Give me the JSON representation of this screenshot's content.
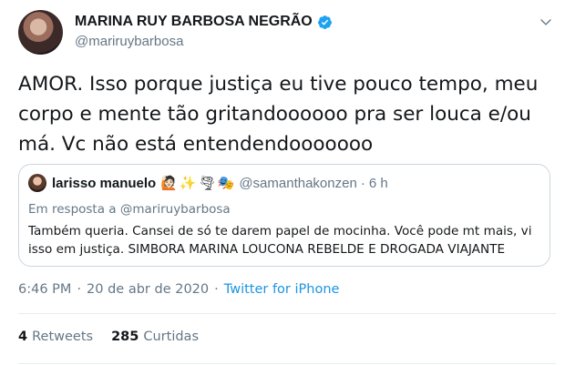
{
  "author": {
    "display_name": "MARINA RUY BARBOSA NEGRÃO",
    "handle": "@mariruybarbosa",
    "verified": true
  },
  "tweet": {
    "line1": "AMOR. Isso porque justiça eu tive pouco tempo, meu",
    "line2": "corpo e mente tão gritandoooooo pra ser louca e/ou",
    "line3": "má. Vc não está entendendooooooo"
  },
  "quote": {
    "name": "larisso manuelo",
    "emojis": [
      "🙋🏻",
      "✨",
      "🌪",
      "🎭"
    ],
    "handle": "@samanthakonzen",
    "dot": "·",
    "time": "6 h",
    "reply_prefix": "Em resposta a",
    "reply_to": "@mariruybarbosa",
    "line1": "Também queria. Cansei de só te darem papel de mocinha. Você pode mt mais, vi",
    "line2": "isso em justiça. SIMBORA MARINA LOUCONA REBELDE E DROGADA VIAJANTE"
  },
  "meta": {
    "time": "6:46 PM",
    "sep": "·",
    "date": "20 de abr de 2020",
    "source": "Twitter for iPhone"
  },
  "stats": {
    "retweets_count": "4",
    "retweets_label": "Retweets",
    "likes_count": "285",
    "likes_label": "Curtidas"
  },
  "colors": {
    "accent": "#1b95e0",
    "muted": "#657786",
    "border": "#ccd6dd",
    "verified_badge": "#1da1f2"
  },
  "icons": {
    "verified": "verified-badge-icon",
    "caret": "chevron-down-icon"
  }
}
